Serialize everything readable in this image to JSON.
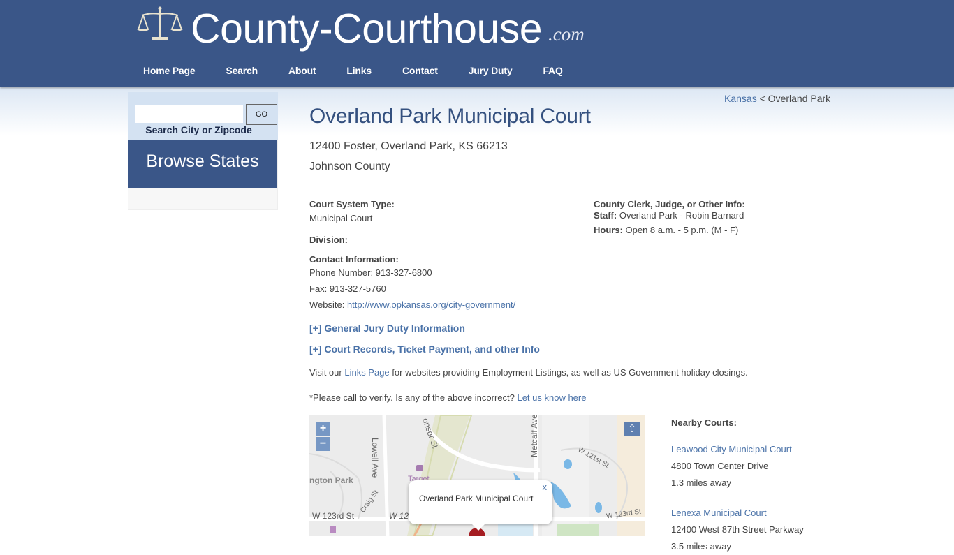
{
  "header": {
    "logo_text": "County-Courthouse",
    "logo_tld": ".com",
    "nav": [
      "Home Page",
      "Search",
      "About",
      "Links",
      "Contact",
      "Jury Duty",
      "FAQ"
    ]
  },
  "sidebar": {
    "search_value": "",
    "go_label": "GO",
    "search_label": "Search City or Zipcode",
    "browse_label": "Browse States"
  },
  "breadcrumb": {
    "state": "Kansas",
    "separator": " < ",
    "city": "Overland Park"
  },
  "court": {
    "title": "Overland Park Municipal Court",
    "address": "12400 Foster, Overland Park, KS 66213",
    "county": "Johnson County",
    "system_type_label": "Court System Type:",
    "system_type": "Municipal Court",
    "division_label": "Division:",
    "contact_label": "Contact Information:",
    "phone": "Phone Number: 913-327-6800",
    "fax": "Fax: 913-327-5760",
    "website_label": "Website: ",
    "website_url": "http://www.opkansas.org/city-government/",
    "other_info_label": "County Clerk, Judge, or Other Info:",
    "staff_label": "Staff:",
    "staff": " Overland Park - Robin Barnard",
    "hours_label": "Hours:",
    "hours": " Open 8 a.m. - 5 p.m. (M - F)"
  },
  "toggles": {
    "jury": "[+] General Jury Duty Information",
    "records": "[+] Court Records, Ticket Payment, and other Info"
  },
  "links_para": {
    "prefix": "Visit our ",
    "link": "Links Page",
    "suffix": " for websites providing Employment Listings, as well as US Government holiday closings."
  },
  "verify_para": {
    "prefix": "*Please call to verify. Is any of the above incorrect? ",
    "link": "Let us know here"
  },
  "map": {
    "zoom_in": "+",
    "zoom_out": "−",
    "fullscreen": "⇧",
    "popup_text": "Overland Park Municipal Court",
    "popup_close": "x",
    "labels": {
      "lowell": "Lowell Ave",
      "metcalf": "Metcalf Ave",
      "conser": "onser St",
      "target": "Target",
      "park": "ngton Park",
      "craig": "Craig St",
      "w123_left": "W 123rd St",
      "w123_mid": "W 12",
      "w121": "W 121st St",
      "w123_right": "W 123rd St"
    }
  },
  "nearby": {
    "heading": "Nearby Courts:",
    "courts": [
      {
        "name": "Leawood City Municipal Court",
        "address": "4800 Town Center Drive",
        "distance": "1.3 miles away"
      },
      {
        "name": "Lenexa Municipal Court",
        "address": "12400 West 87th Street Parkway",
        "distance": "3.5 miles away"
      }
    ]
  }
}
